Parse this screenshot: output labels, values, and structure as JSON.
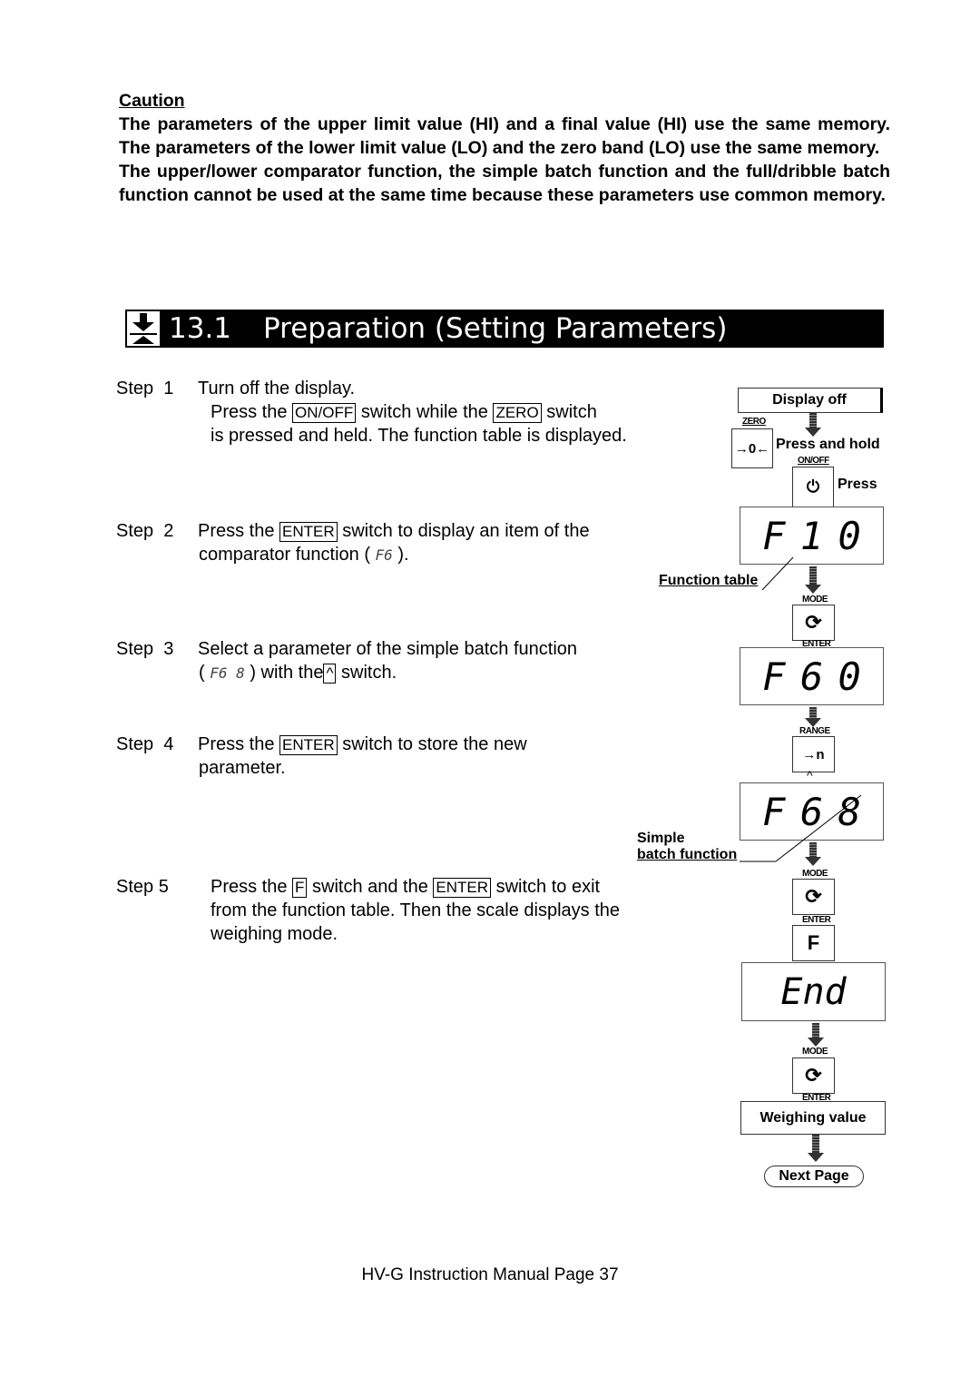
{
  "caution": {
    "title": "Caution",
    "paragraphs": [
      "The parameters of the upper limit value (HI) and a final value (HI) use the same memory. The parameters of the lower limit value (LO) and the zero band (LO) use the same memory.",
      "The upper/lower comparator function, the simple batch function and the full/dribble batch function cannot be used at the same time because these parameters use common memory."
    ]
  },
  "section": {
    "number": "13.1",
    "title": "Preparation (Setting Parameters)",
    "icon": "weighing-down-arrow-icon"
  },
  "steps": [
    {
      "label": "Step  1",
      "line1": "Turn off the display.",
      "l2a": "Press the",
      "k1": "ON/OFF",
      "l2b": "switch while the",
      "k2": "ZERO",
      "l2c": "switch",
      "line3": "is  pressed and held. The function table is displayed."
    },
    {
      "label": "Step  2",
      "a": "Press the",
      "k1": "ENTER",
      "b": "switch to display an item of the",
      "c": "comparator function (",
      "seg": "F6",
      "d": ")."
    },
    {
      "label": "Step  3",
      "a": "Select a parameter of the simple batch function",
      "b": "(",
      "seg": "F6 8",
      "c": ") with the",
      "k1": "^",
      "d": "switch."
    },
    {
      "label": "Step  4",
      "a": "Press the",
      "k1": "ENTER",
      "b": "switch to store the new",
      "c": "parameter."
    },
    {
      "label": "Step 5",
      "a": "Press the",
      "k1": "F",
      "b": "switch and the",
      "k2": "ENTER",
      "c": "switch to exit",
      "d": "from the function table. Then the scale displays the",
      "e": "weighing mode."
    }
  ],
  "diagram": {
    "display_off": "Display off",
    "zero_label": "ZERO",
    "zero_symbol": "→0←",
    "press_and_hold": "Press and hold",
    "onoff_label": "ON/OFF",
    "onoff_symbol": "⏻",
    "press": "Press",
    "display1": [
      "F",
      "1",
      "0"
    ],
    "function_table": "Function table",
    "mode_label": "MODE",
    "enter_label": "ENTER",
    "cycle_symbol": "⟳",
    "display2": [
      "F",
      "6",
      "0"
    ],
    "range_label": "RANGE",
    "range_symbol": "→n",
    "caret": "^",
    "display3": [
      "F",
      "6",
      "8"
    ],
    "simple_batch_1": "Simple",
    "simple_batch_2": "batch function",
    "f_key": "F",
    "display4": "End",
    "weighing_value": "Weighing value",
    "next_page": "Next Page"
  },
  "footer": "HV-G Instruction Manual Page 37"
}
